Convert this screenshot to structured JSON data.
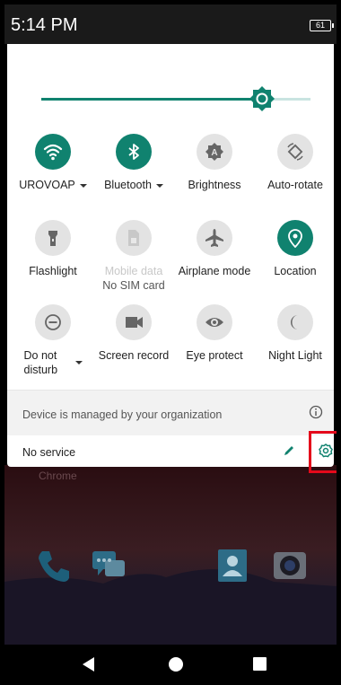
{
  "status_bar": {
    "time": "5:14 PM",
    "battery": "61"
  },
  "brightness_slider": {
    "level_fraction": 0.82
  },
  "tiles": [
    {
      "name": "wifi",
      "label": "UROVOAP",
      "state": "on",
      "icon": "wifi-icon",
      "has_dropdown": true
    },
    {
      "name": "bluetooth",
      "label": "Bluetooth",
      "state": "on",
      "icon": "bluetooth-icon",
      "has_dropdown": true
    },
    {
      "name": "brightness",
      "label": "Brightness",
      "state": "off",
      "icon": "brightness-icon"
    },
    {
      "name": "auto-rotate",
      "label": "Auto-rotate",
      "state": "off",
      "icon": "rotate-icon"
    },
    {
      "name": "flashlight",
      "label": "Flashlight",
      "state": "off",
      "icon": "flashlight-icon"
    },
    {
      "name": "mobile-data",
      "label": "Mobile data",
      "sublabel": "No SIM card",
      "state": "disabled",
      "icon": "sim-card-icon"
    },
    {
      "name": "airplane",
      "label": "Airplane mode",
      "state": "off",
      "icon": "airplane-icon"
    },
    {
      "name": "location",
      "label": "Location",
      "state": "on",
      "icon": "location-icon"
    },
    {
      "name": "dnd",
      "label": "Do not disturb",
      "state": "off",
      "icon": "do-not-disturb-icon",
      "has_dropdown": true
    },
    {
      "name": "screen-record",
      "label": "Screen record",
      "state": "off",
      "icon": "video-camera-icon"
    },
    {
      "name": "eye-protect",
      "label": "Eye protect",
      "state": "off",
      "icon": "eye-icon"
    },
    {
      "name": "night-light",
      "label": "Night Light",
      "state": "off",
      "icon": "moon-icon"
    }
  ],
  "managed_notice": "Device is managed by your organization",
  "carrier_text": "No service",
  "wallpaper": {
    "app_label": "Chrome"
  },
  "colors": {
    "accent": "#10826f",
    "tile_off": "#e3e3e3",
    "highlight": "#e4091b"
  }
}
